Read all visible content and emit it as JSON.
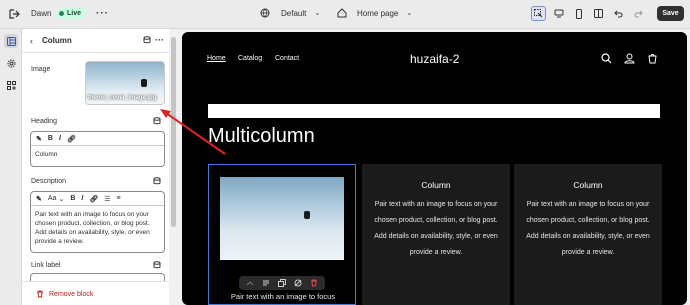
{
  "topbar": {
    "store_name": "Dawn",
    "live_badge": "Live",
    "more": "···",
    "theme": "Default",
    "page": "Home page",
    "save_label": "Save"
  },
  "panel": {
    "title": "Column",
    "image_label": "Image",
    "image_filename": "theme_cover_image.jpg",
    "heading_label": "Heading",
    "heading_value": "Column",
    "description_label": "Description",
    "description_value": "Pair text with an image to focus on your chosen product, collection, or blog post. Add details on availability, style, or even provide a review.",
    "link_label": "Link label",
    "remove_label": "Remove block",
    "heading_toolbar": [
      "B",
      "I"
    ],
    "description_toolbar": [
      "Aa",
      "B",
      "I"
    ]
  },
  "site": {
    "nav": [
      "Home",
      "Catalog",
      "Contact"
    ],
    "brand": "huzaifa-2",
    "section_heading": "Multicolumn",
    "columns": [
      {
        "title": "",
        "text": "Pair text with an image to focus"
      },
      {
        "title": "Column",
        "text": "Pair text with an image to focus on your chosen product, collection, or blog post. Add details on availability, style, or even provide a review."
      },
      {
        "title": "Column",
        "text": "Pair text with an image to focus on your chosen product, collection, or blog post. Add details on availability, style, or even provide a review."
      }
    ]
  },
  "colors": {
    "accent_save": "#303030",
    "live_bg": "#cdfee1",
    "selection_outline": "#4a7bd6",
    "remove_red": "#b42318",
    "annotation_arrow": "#e02424"
  }
}
